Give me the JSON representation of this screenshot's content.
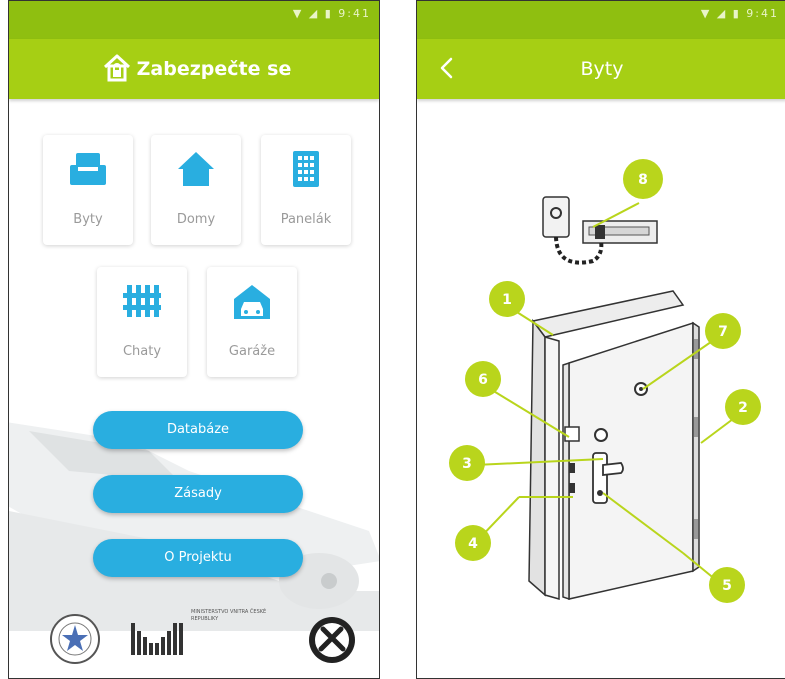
{
  "left_screen": {
    "status_time": "9:41",
    "app_title": "Zabezpečte se",
    "categories": [
      {
        "label": "Byty",
        "icon": "sofa-icon"
      },
      {
        "label": "Domy",
        "icon": "house-icon"
      },
      {
        "label": "Panelák",
        "icon": "building-icon"
      },
      {
        "label": "Chaty",
        "icon": "fence-icon"
      },
      {
        "label": "Garáže",
        "icon": "garage-icon"
      }
    ],
    "buttons": {
      "database": "Databáze",
      "principles": "Zásady",
      "about": "O Projektu"
    },
    "ministry_name": "MINISTERSTVO VNITRA ČESKÉ REPUBLIKY",
    "colors": {
      "header": "#a6cf14",
      "button": "#29aee0",
      "icon": "#29aee0"
    }
  },
  "right_screen": {
    "status_time": "9:41",
    "title": "Byty",
    "markers": [
      "1",
      "2",
      "3",
      "4",
      "5",
      "6",
      "7",
      "8"
    ],
    "marker_color": "#b9d51c"
  }
}
